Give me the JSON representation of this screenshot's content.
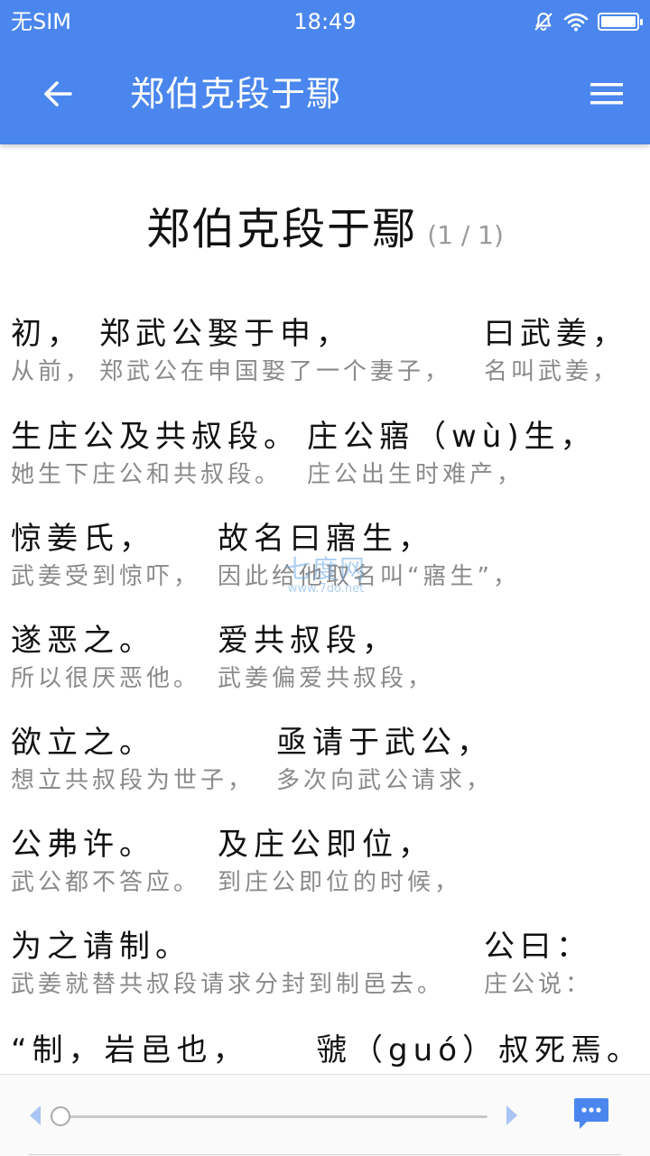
{
  "status_bar": {
    "carrier": "无SIM",
    "time": "18:49",
    "battery_level": 1.0,
    "icons": [
      "bell-muted-icon",
      "wifi-icon",
      "battery-icon"
    ]
  },
  "app_bar": {
    "title": "郑伯克段于鄢",
    "back_icon": "arrow-left-icon",
    "menu_icon": "hamburger-menu-icon",
    "color": "#4a86ee"
  },
  "article": {
    "title": "郑伯克段于鄢",
    "page_indicator": "(1 / 1)",
    "verses": [
      {
        "orig": [
          "初，",
          "郑武公娶于申，",
          "曰武姜，"
        ],
        "trans": [
          "从前，",
          "郑武公在申国娶了一个妻子，",
          "名叫武姜，"
        ]
      },
      {
        "orig": [
          "生庄公及共叔段。",
          "庄公寤（wù)生，"
        ],
        "trans": [
          "她生下庄公和共叔段。",
          "庄公出生时难产，"
        ]
      },
      {
        "orig": [
          "惊姜氏，",
          "故名曰寤生，"
        ],
        "trans": [
          "武姜受到惊吓，",
          "因此给他取名叫“寤生”，"
        ]
      },
      {
        "orig": [
          "遂恶之。",
          "爱共叔段，"
        ],
        "trans": [
          "所以很厌恶他。",
          "武姜偏爱共叔段，"
        ]
      },
      {
        "orig": [
          "欲立之。",
          "亟请于武公，"
        ],
        "trans": [
          "想立共叔段为世子，",
          "多次向武公请求，"
        ]
      },
      {
        "orig": [
          "公弗许。",
          "及庄公即位，"
        ],
        "trans": [
          "武公都不答应。",
          "到庄公即位的时候，"
        ]
      },
      {
        "orig": [
          "为之请制。",
          "公曰："
        ],
        "trans": [
          "武姜就替共叔段请求分封到制邑去。",
          "庄公说："
        ]
      },
      {
        "orig": [
          "“制，岩邑也，",
          "虢（guó）叔死焉。"
        ],
        "trans": []
      }
    ]
  },
  "watermark": {
    "title": "七度网",
    "url": "www.7do.net"
  },
  "bottom_bar": {
    "slider_value": 0,
    "prev_icon": "triangle-left-icon",
    "next_icon": "triangle-right-icon",
    "comment_icon": "comment-bubble-icon",
    "accent": "#4a86ee"
  }
}
